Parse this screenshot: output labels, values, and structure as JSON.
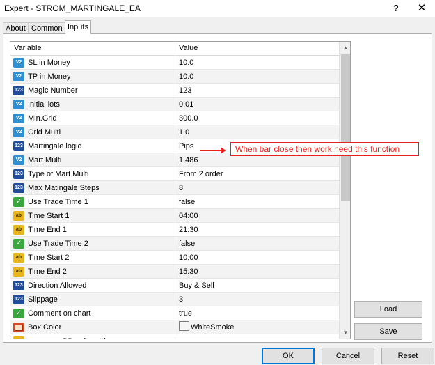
{
  "window": {
    "title": "Expert - STROM_MARTINGALE_EA",
    "help_glyph": "?",
    "close_glyph": "✕"
  },
  "tabs": [
    {
      "label": "About"
    },
    {
      "label": "Common"
    },
    {
      "label": "Inputs",
      "active": true
    }
  ],
  "table": {
    "headers": {
      "variable": "Variable",
      "value": "Value"
    },
    "rows": [
      {
        "icon": "v2",
        "name": "SL in Money",
        "value": "10.0"
      },
      {
        "icon": "v2",
        "name": "TP in Money",
        "value": "10.0"
      },
      {
        "icon": "num",
        "name": "Magic Number",
        "value": "123"
      },
      {
        "icon": "v2",
        "name": "Initial lots",
        "value": "0.01"
      },
      {
        "icon": "v2",
        "name": "Min.Grid",
        "value": "300.0"
      },
      {
        "icon": "v2",
        "name": "Grid Multi",
        "value": "1.0"
      },
      {
        "icon": "num",
        "name": "Martingale logic",
        "value": "Pips"
      },
      {
        "icon": "v2",
        "name": "Mart Multi",
        "value": "1.486"
      },
      {
        "icon": "num",
        "name": "Type of Mart Multi",
        "value": "From 2 order"
      },
      {
        "icon": "num",
        "name": "Max Matingale Steps",
        "value": "8"
      },
      {
        "icon": "bool",
        "name": "Use Trade Time 1",
        "value": "false"
      },
      {
        "icon": "str",
        "name": "Time Start 1",
        "value": "04:00"
      },
      {
        "icon": "str",
        "name": "Time End 1",
        "value": "21:30"
      },
      {
        "icon": "bool",
        "name": "Use Trade Time 2",
        "value": "false"
      },
      {
        "icon": "str",
        "name": "Time Start 2",
        "value": "10:00"
      },
      {
        "icon": "str",
        "name": "Time End 2",
        "value": "15:30"
      },
      {
        "icon": "num",
        "name": "Direction Allowed",
        "value": "Buy & Sell"
      },
      {
        "icon": "num",
        "name": "Slippage",
        "value": "3"
      },
      {
        "icon": "bool",
        "name": "Comment on chart",
        "value": "true"
      },
      {
        "icon": "col",
        "name": "Box Color",
        "value": "WhiteSmoke"
      },
      {
        "icon": "str",
        "name": "BBands settings",
        "value": "=================================="
      }
    ]
  },
  "annotation": {
    "text": "When bar close then work need this function",
    "color": "#e8211c"
  },
  "buttons": {
    "load": "Load",
    "save": "Save",
    "ok": "OK",
    "cancel": "Cancel",
    "reset": "Reset"
  },
  "icons": {
    "v2": {
      "semantic": "double-type-icon",
      "glyph": "V2"
    },
    "num": {
      "semantic": "integer-type-icon",
      "glyph": "123"
    },
    "bool": {
      "semantic": "bool-type-icon",
      "glyph": "✓"
    },
    "str": {
      "semantic": "string-type-icon",
      "glyph": "ab"
    },
    "col": {
      "semantic": "color-type-icon",
      "glyph": ""
    }
  },
  "colors": {
    "accent": "#0078d7",
    "annotation": "#e8211c"
  }
}
